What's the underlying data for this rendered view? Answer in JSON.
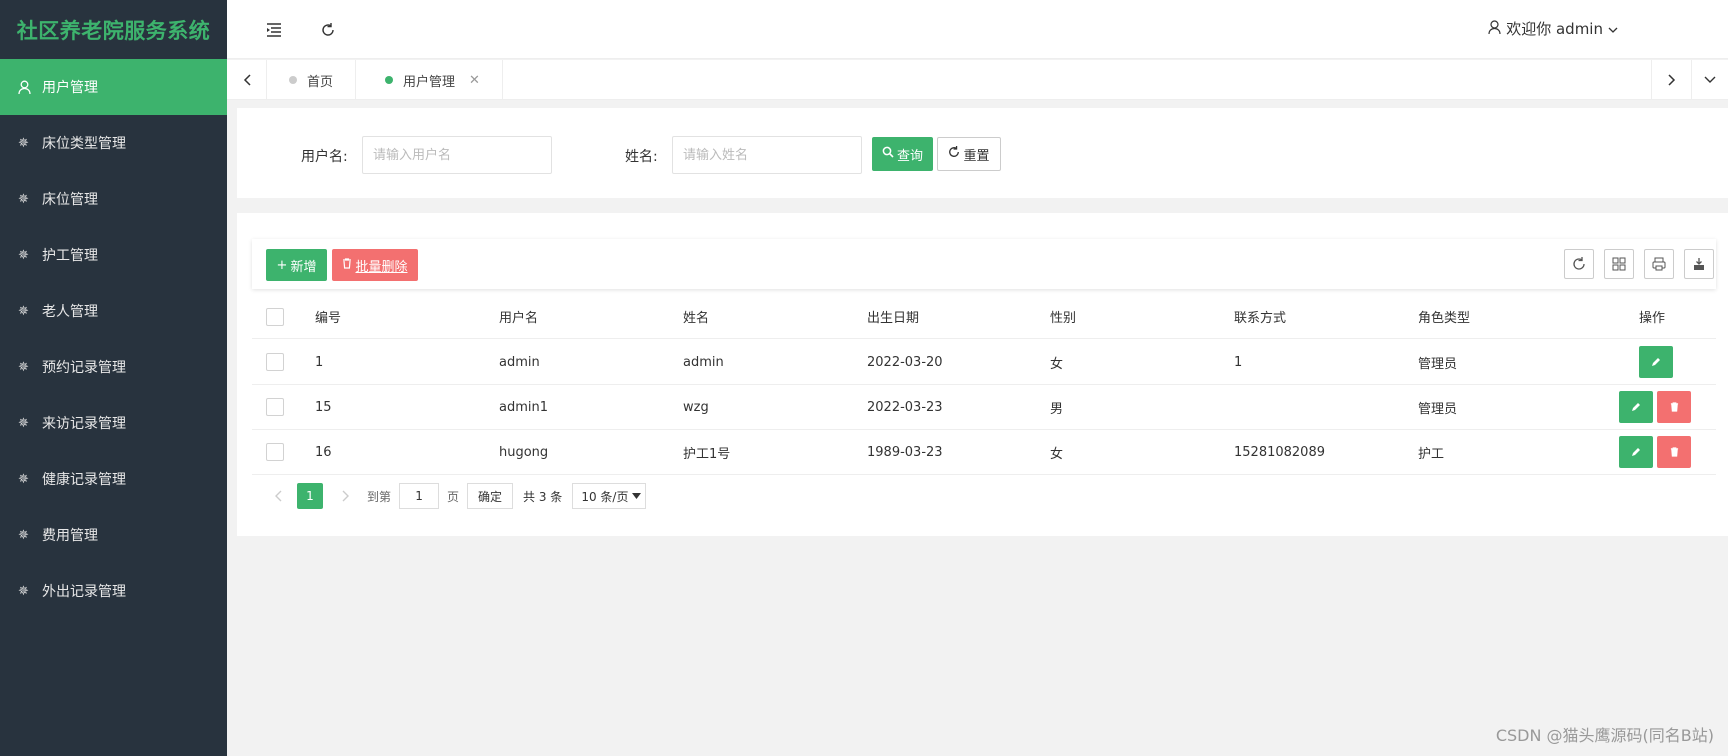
{
  "app": {
    "title": "社区养老院服务系统"
  },
  "sidebar": {
    "items": [
      {
        "label": "用户管理",
        "active": true
      },
      {
        "label": "床位类型管理"
      },
      {
        "label": "床位管理"
      },
      {
        "label": "护工管理"
      },
      {
        "label": "老人管理"
      },
      {
        "label": "预约记录管理"
      },
      {
        "label": "来访记录管理"
      },
      {
        "label": "健康记录管理"
      },
      {
        "label": "费用管理"
      },
      {
        "label": "外出记录管理"
      }
    ]
  },
  "header": {
    "user_text": "欢迎你 admin"
  },
  "tabs": [
    {
      "label": "首页"
    },
    {
      "label": "用户管理",
      "active": true
    }
  ],
  "search": {
    "username_label": "用户名:",
    "username_placeholder": "请输入用户名",
    "name_label": "姓名:",
    "name_placeholder": "请输入姓名",
    "query_label": "查询",
    "reset_label": "重置"
  },
  "toolbar": {
    "add_label": "新增",
    "batch_delete_label": "批量删除"
  },
  "table": {
    "columns": [
      "编号",
      "用户名",
      "姓名",
      "出生日期",
      "性别",
      "联系方式",
      "角色类型",
      "操作"
    ],
    "rows": [
      {
        "id": "1",
        "username": "admin",
        "name": "admin",
        "birth": "2022-03-20",
        "gender": "女",
        "phone": "1",
        "role": "管理员",
        "deletable": false
      },
      {
        "id": "15",
        "username": "admin1",
        "name": "wzg",
        "birth": "2022-03-23",
        "gender": "男",
        "phone": "",
        "role": "管理员",
        "deletable": true
      },
      {
        "id": "16",
        "username": "hugong",
        "name": "护工1号",
        "birth": "1989-03-23",
        "gender": "女",
        "phone": "15281082089",
        "role": "护工",
        "deletable": true
      }
    ]
  },
  "pagination": {
    "current": "1",
    "goto_label": "到第",
    "goto_value": "1",
    "page_suffix": "页",
    "confirm_label": "确定",
    "total_text": "共 3 条",
    "page_size": "10 条/页"
  },
  "watermark": "CSDN @猫头鹰源码(同名B站)",
  "colors": {
    "primary": "#3db36d",
    "danger": "#f37070",
    "sidebar_bg": "#28333e"
  }
}
